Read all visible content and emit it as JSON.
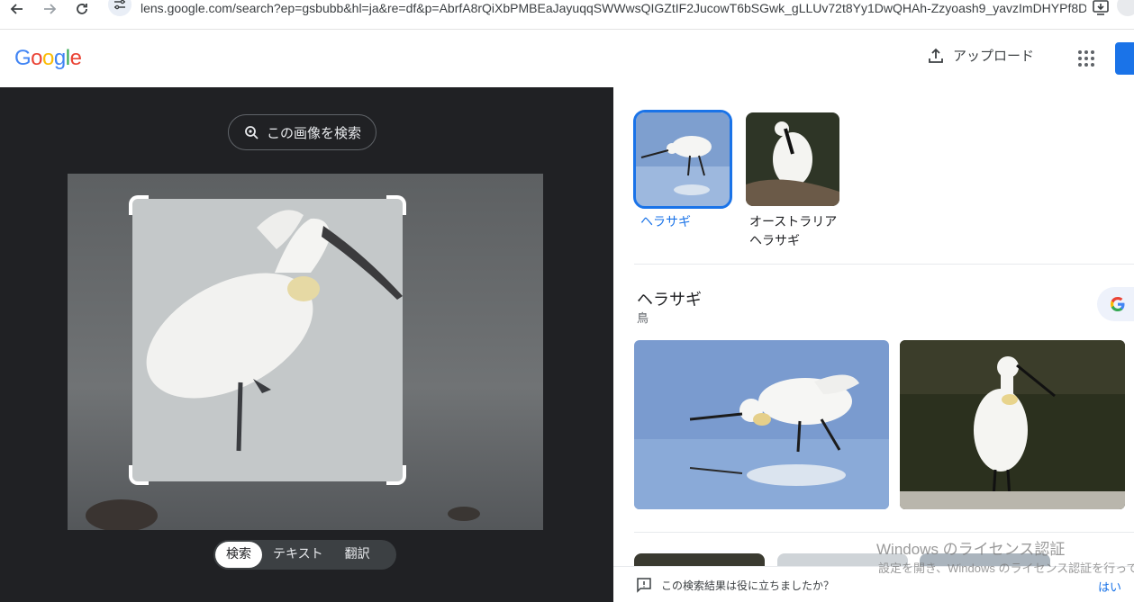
{
  "browser": {
    "url": "lens.google.com/search?ep=gsbubb&hl=ja&re=df&p=AbrfA8rQiXbPMBEaJayuqqSWWwsQIGZtIF2JucowT6bSGwk_gLLUv72t8Yy1DwQHAh-Zzyoash9_yavzImDHYPf8Dc7..."
  },
  "header": {
    "logo_letters": [
      "G",
      "o",
      "o",
      "g",
      "l",
      "e"
    ],
    "logo_colors": [
      "#4285f4",
      "#ea4335",
      "#fbbc05",
      "#4285f4",
      "#34a853",
      "#ea4335"
    ],
    "upload_label": "アップロード"
  },
  "left": {
    "search_image_label": "この画像を検索",
    "modes": [
      "検索",
      "テキスト",
      "翻訳"
    ],
    "active_mode": "検索"
  },
  "right": {
    "thumbnails": [
      {
        "label": "ヘラサギ",
        "selected": true
      },
      {
        "label": "オーストラリアヘラサギ",
        "selected": false
      }
    ],
    "entity_title": "ヘラサギ",
    "entity_subtitle": "鳥",
    "feedback_text": "この検索結果は役に立ちましたか？",
    "feedback_yes": "はい"
  },
  "watermark": {
    "title": "Windows のライセンス認証",
    "subtitle": "設定を開き、Windows のライセンス認証を行って"
  },
  "colors": {
    "accent": "#1a73e8",
    "dark_pane": "#202124"
  }
}
